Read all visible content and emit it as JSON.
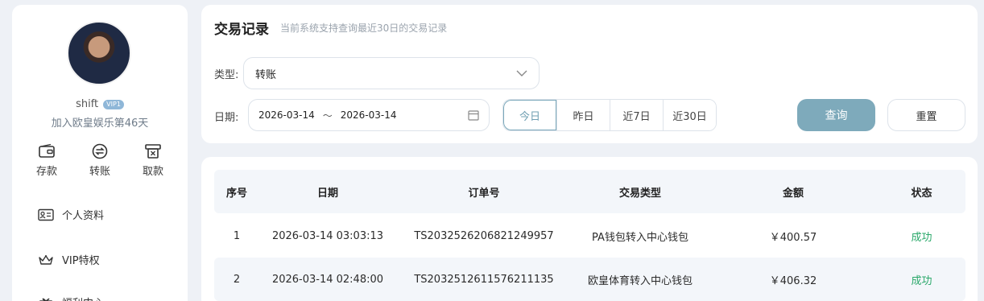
{
  "user": {
    "name": "shift",
    "vip_badge": "VIP1",
    "join_text": "加入欧皇娱乐第46天"
  },
  "quick_actions": [
    {
      "label": "存款",
      "icon": "wallet-icon"
    },
    {
      "label": "转账",
      "icon": "transfer-icon"
    },
    {
      "label": "取款",
      "icon": "withdraw-icon"
    }
  ],
  "menu": {
    "profile": "个人资料",
    "vip": "VIP特权",
    "partial": "福利中心"
  },
  "header": {
    "title": "交易记录",
    "subtitle": "当前系统支持查询最近30日的交易记录"
  },
  "filters": {
    "type_label": "类型:",
    "type_value": "转账",
    "date_label": "日期:",
    "date_start": "2026-03-14",
    "date_sep": "～",
    "date_end": "2026-03-14",
    "quick_dates": [
      "今日",
      "昨日",
      "近7日",
      "近30日"
    ],
    "query_label": "查询",
    "reset_label": "重置"
  },
  "table": {
    "columns": [
      "序号",
      "日期",
      "订单号",
      "交易类型",
      "金额",
      "状态"
    ],
    "rows": [
      {
        "no": "1",
        "date": "2026-03-14 03:03:13",
        "order": "TS2032526206821249957",
        "type": "PA钱包转入中心钱包",
        "amount": "￥400.57",
        "status": "成功"
      },
      {
        "no": "2",
        "date": "2026-03-14 02:48:00",
        "order": "TS2032512611576211135",
        "type": "欧皇体育转入中心钱包",
        "amount": "￥406.32",
        "status": "成功"
      }
    ]
  },
  "colors": {
    "accent": "#7eaabb",
    "success": "#2aa86a",
    "background": "#eef1f6"
  }
}
